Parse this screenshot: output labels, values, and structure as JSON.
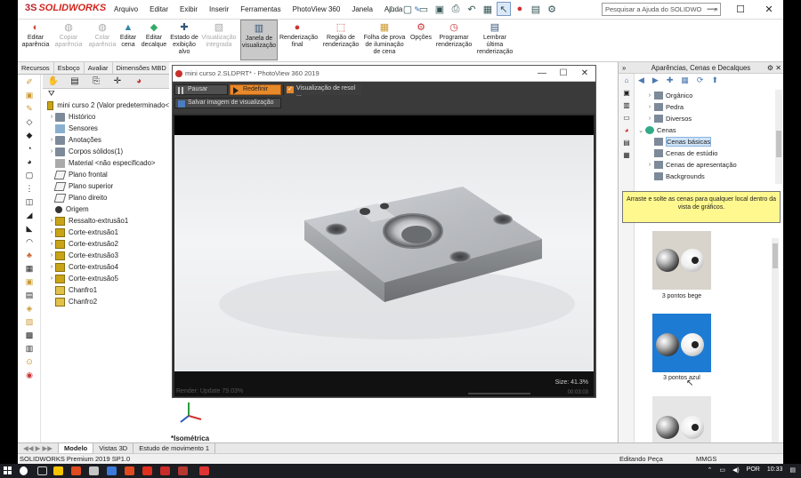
{
  "app": {
    "logo": "SOLIDWORKS",
    "menu": [
      "Arquivo",
      "Editar",
      "Exibir",
      "Inserir",
      "Ferramentas",
      "PhotoView 360",
      "Janela",
      "Ajuda"
    ],
    "help_placeholder": "Pesquisar a Ajuda do SOLIDWO",
    "window_controls": [
      "minimize-icon",
      "maximize-icon",
      "close-icon"
    ]
  },
  "ribbon": [
    {
      "label": "Editar aparência",
      "icon": "appearance-icon",
      "enabled": true,
      "active": false
    },
    {
      "label": "Copiar aparência",
      "icon": "copy-appearance-icon",
      "enabled": false,
      "active": false
    },
    {
      "label": "Colar aparência",
      "icon": "paste-appearance-icon",
      "enabled": false,
      "active": false
    },
    {
      "label": "Editar cena",
      "icon": "scene-icon",
      "enabled": true,
      "active": false
    },
    {
      "label": "Editar decalque",
      "icon": "decal-icon",
      "enabled": true,
      "active": false
    },
    {
      "label": "Estado de exibição alvo",
      "icon": "display-state-icon",
      "enabled": true,
      "active": false
    },
    {
      "label": "Visualização integrada",
      "icon": "integrated-preview-icon",
      "enabled": false,
      "active": false
    },
    {
      "label": "Janela de visualização",
      "icon": "preview-window-icon",
      "enabled": true,
      "active": true
    },
    {
      "label": "Renderização final",
      "icon": "final-render-icon",
      "enabled": true,
      "active": false
    },
    {
      "label": "Região de renderização",
      "icon": "render-region-icon",
      "enabled": true,
      "active": false
    },
    {
      "label": "Folha de prova de iluminação de cena",
      "icon": "proof-sheet-icon",
      "enabled": true,
      "active": false
    },
    {
      "label": "Opções",
      "icon": "options-icon",
      "enabled": true,
      "active": false
    },
    {
      "label": "Programar renderização",
      "icon": "schedule-render-icon",
      "enabled": true,
      "active": false
    },
    {
      "label": "Lembrar última renderização",
      "icon": "recall-render-icon",
      "enabled": true,
      "active": false
    }
  ],
  "left_tabs": [
    "Recursos",
    "Esboço",
    "Avaliar",
    "Dimensões MBD"
  ],
  "feature_tree": {
    "root": "mini curso 2  (Valor predeterminado<",
    "items": [
      {
        "label": "Histórico",
        "icon": "history-icon",
        "expand": true
      },
      {
        "label": "Sensores",
        "icon": "sensor-icon",
        "expand": false
      },
      {
        "label": "Anotações",
        "icon": "annotation-icon",
        "expand": true
      },
      {
        "label": "Corpos sólidos(1)",
        "icon": "solid-bodies-icon",
        "expand": true
      },
      {
        "label": "Material <não especificado>",
        "icon": "material-icon",
        "expand": false
      },
      {
        "label": "Plano frontal",
        "icon": "plane-icon",
        "expand": false
      },
      {
        "label": "Plano superior",
        "icon": "plane-icon",
        "expand": false
      },
      {
        "label": "Plano direito",
        "icon": "plane-icon",
        "expand": false
      },
      {
        "label": "Origem",
        "icon": "origin-icon",
        "expand": false
      },
      {
        "label": "Ressalto-extrusão1",
        "icon": "boss-extrude-icon",
        "expand": true
      },
      {
        "label": "Corte-extrusão1",
        "icon": "cut-extrude-icon",
        "expand": true
      },
      {
        "label": "Corte-extrusão2",
        "icon": "cut-extrude-icon",
        "expand": true
      },
      {
        "label": "Corte-extrusão3",
        "icon": "cut-extrude-icon",
        "expand": true
      },
      {
        "label": "Corte-extrusão4",
        "icon": "cut-extrude-icon",
        "expand": true
      },
      {
        "label": "Corte-extrusão5",
        "icon": "cut-extrude-icon",
        "expand": true
      },
      {
        "label": "Chanfro1",
        "icon": "chamfer-icon",
        "expand": false
      },
      {
        "label": "Chanfro2",
        "icon": "chamfer-icon",
        "expand": false
      }
    ]
  },
  "photoview": {
    "title": "mini curso 2.SLDPRT* - PhotoView 360 2019",
    "pause_label": "Pausar",
    "reset_label": "Redefinir",
    "res_label": "Visualização de resol ...",
    "save_label": "Salvar imagem de visualização",
    "render_status": "Render: Update 79.03%",
    "size": "Size: 41.3%",
    "time": "00:03:03"
  },
  "graphics": {
    "view_label": "*Isométrica"
  },
  "bottom_tabs": [
    "Modelo",
    "Vistas 3D",
    "Estudo de movimento 1"
  ],
  "bottom_active": "Modelo",
  "status": {
    "version": "SOLIDWORKS Premium 2019 SP1.0",
    "mode": "Editando Peça",
    "units": "MMGS"
  },
  "task_pane": {
    "title": "Aparências, Cenas e Decalques",
    "tree": [
      {
        "label": "Orgânico",
        "indent": 1,
        "expand": true,
        "selected": false
      },
      {
        "label": "Pedra",
        "indent": 1,
        "expand": true,
        "selected": false
      },
      {
        "label": "Diversos",
        "indent": 1,
        "expand": true,
        "selected": false
      },
      {
        "label": "Cenas",
        "indent": 0,
        "expand": true,
        "open": true,
        "selected": false
      },
      {
        "label": "Cenas básicas",
        "indent": 1,
        "expand": false,
        "selected": true
      },
      {
        "label": "Cenas de estúdio",
        "indent": 1,
        "expand": false,
        "selected": false
      },
      {
        "label": "Cenas de apresentação",
        "indent": 1,
        "expand": true,
        "selected": false
      },
      {
        "label": "Backgrounds",
        "indent": 1,
        "expand": false,
        "selected": false
      }
    ],
    "hint": "Arraste e solte as cenas para qualquer local dentro da vista de gráficos.",
    "thumbnails": [
      {
        "label": "3 pontos bege",
        "bg": "#d8d4cc"
      },
      {
        "label": "3 pontos azul",
        "bg": "#1e7bd3"
      },
      {
        "label": "",
        "bg": "#e6e6e6"
      }
    ]
  },
  "taskbar": {
    "lang": "POR",
    "time": "10:33"
  }
}
